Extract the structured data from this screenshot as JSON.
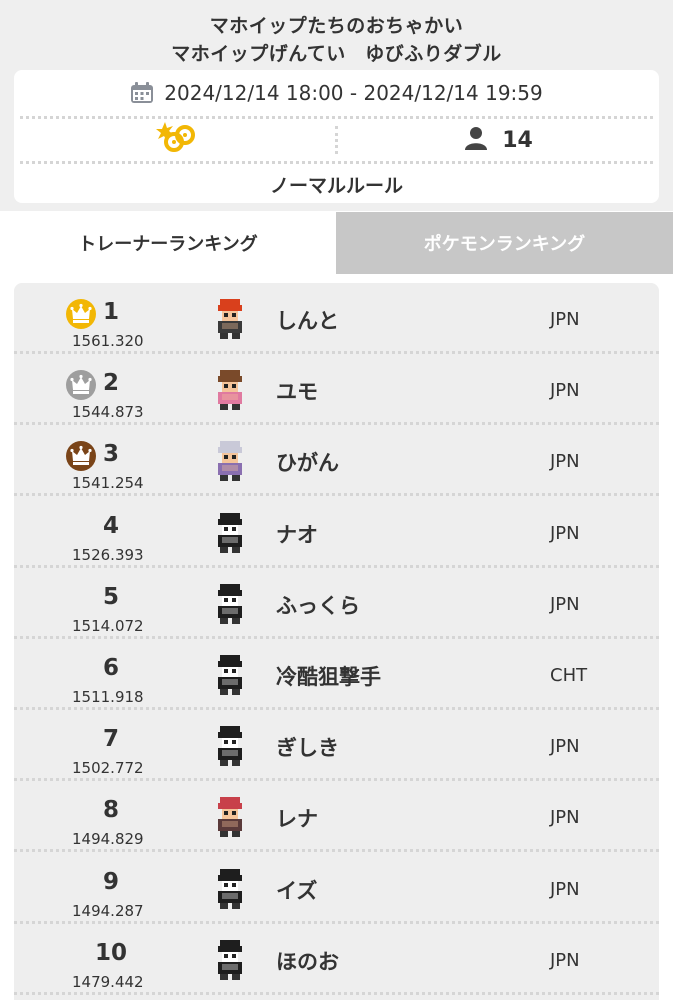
{
  "header": {
    "title": "マホイップたちのおちゃかい",
    "subtitle": "マホイップげんてい　ゆびふりダブル"
  },
  "info": {
    "date_range": "2024/12/14 18:00 - 2024/12/14 19:59",
    "players": "14",
    "rule": "ノーマルルール",
    "icons": {
      "calendar": "calendar-icon",
      "battle": "battle-format-icon",
      "person": "person-icon"
    },
    "colors": {
      "battle_icon": "#f2b705"
    }
  },
  "tabs": [
    {
      "label": "トレーナーランキング",
      "active": true
    },
    {
      "label": "ポケモンランキング",
      "active": false
    }
  ],
  "crown_colors": {
    "gold": "#f2b705",
    "silver": "#9e9e9e",
    "bronze": "#7a4418"
  },
  "rankings": [
    {
      "rank": "1",
      "score": "1561.320",
      "name": "しんと",
      "region": "JPN",
      "crown": "gold"
    },
    {
      "rank": "2",
      "score": "1544.873",
      "name": "ユモ",
      "region": "JPN",
      "crown": "silver"
    },
    {
      "rank": "3",
      "score": "1541.254",
      "name": "ひがん",
      "region": "JPN",
      "crown": "bronze"
    },
    {
      "rank": "4",
      "score": "1526.393",
      "name": "ナオ",
      "region": "JPN",
      "crown": ""
    },
    {
      "rank": "5",
      "score": "1514.072",
      "name": "ふっくら",
      "region": "JPN",
      "crown": ""
    },
    {
      "rank": "6",
      "score": "1511.918",
      "name": "冷酷狙撃手",
      "region": "CHT",
      "crown": ""
    },
    {
      "rank": "7",
      "score": "1502.772",
      "name": "ぎしき",
      "region": "JPN",
      "crown": ""
    },
    {
      "rank": "8",
      "score": "1494.829",
      "name": "レナ",
      "region": "JPN",
      "crown": ""
    },
    {
      "rank": "9",
      "score": "1494.287",
      "name": "イズ",
      "region": "JPN",
      "crown": ""
    },
    {
      "rank": "10",
      "score": "1479.442",
      "name": "ほのお",
      "region": "JPN",
      "crown": ""
    }
  ]
}
